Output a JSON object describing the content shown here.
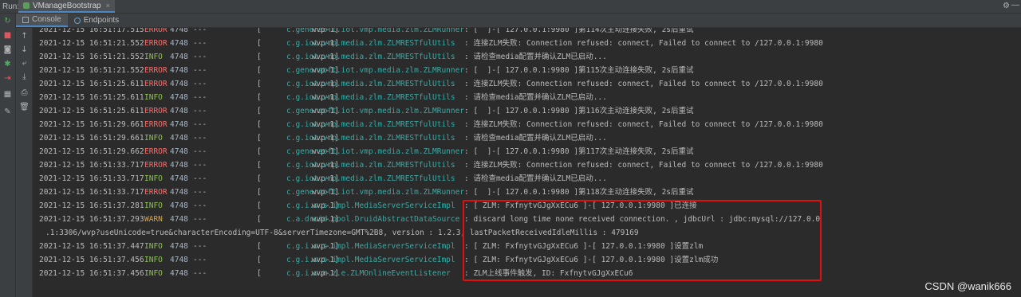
{
  "topbar": {
    "run_label": "Run:",
    "run_tab": "VManageBootstrap",
    "close": "×",
    "gear": "⚙",
    "minimize": "—"
  },
  "subbar": {
    "tabs": [
      {
        "label": "Console"
      },
      {
        "label": "Endpoints"
      }
    ]
  },
  "toolbar_icons": [
    {
      "name": "rerun-icon",
      "glyph": "↻",
      "color": "#59a869"
    },
    {
      "name": "stop-icon",
      "glyph": "■",
      "color": "#db5860"
    },
    {
      "name": "screenshot-icon",
      "glyph": "◙",
      "color": "#afb1b3"
    },
    {
      "name": "debug-icon",
      "glyph": "✱",
      "color": "#59a869"
    },
    {
      "name": "exit-icon",
      "glyph": "⇥",
      "color": "#db5860"
    },
    {
      "name": "layout-icon",
      "glyph": "▦",
      "color": "#afb1b3"
    },
    {
      "name": "pin-icon",
      "glyph": "✎",
      "color": "#afb1b3"
    }
  ],
  "console_icons": [
    {
      "name": "scroll-up-icon",
      "glyph": "↑"
    },
    {
      "name": "scroll-down-icon",
      "glyph": "↓"
    },
    {
      "name": "soft-wrap-icon",
      "glyph": "⤶"
    },
    {
      "name": "scroll-to-end-icon",
      "glyph": "⤓"
    },
    {
      "name": "print-icon",
      "glyph": "⎙"
    },
    {
      "name": "clear-icon",
      "glyph": "🗑"
    }
  ],
  "log_lines": [
    {
      "ts": "2021-12-15 16:51:17.515",
      "level": "ERROR",
      "pid": "4748",
      "dash": "---",
      "thread": "[           wvp-1]",
      "logger": "c.genersoft.iot.vmp.media.zlm.ZLMRunner",
      "msg": ": [  ]-[ 127.0.0.1:9980 ]第114次主动连接失败, 2s后重试"
    },
    {
      "ts": "2021-12-15 16:51:21.552",
      "level": "ERROR",
      "pid": "4748",
      "dash": "---",
      "thread": "[           wvp-1]",
      "logger": "c.g.iot.vmp.media.zlm.ZLMRESTfulUtils",
      "msg": ": 连接ZLM失败: Connection refused: connect, Failed to connect to /127.0.0.1:9980"
    },
    {
      "ts": "2021-12-15 16:51:21.552",
      "level": "INFO",
      "pid": "4748",
      "dash": "---",
      "thread": "[           wvp-1]",
      "logger": "c.g.iot.vmp.media.zlm.ZLMRESTfulUtils",
      "msg": ": 请检查media配置并确认ZLM已启动..."
    },
    {
      "ts": "2021-12-15 16:51:21.552",
      "level": "ERROR",
      "pid": "4748",
      "dash": "---",
      "thread": "[           wvp-1]",
      "logger": "c.genersoft.iot.vmp.media.zlm.ZLMRunner",
      "msg": ": [  ]-[ 127.0.0.1:9980 ]第115次主动连接失败, 2s后重试"
    },
    {
      "ts": "2021-12-15 16:51:25.611",
      "level": "ERROR",
      "pid": "4748",
      "dash": "---",
      "thread": "[           wvp-1]",
      "logger": "c.g.iot.vmp.media.zlm.ZLMRESTfulUtils",
      "msg": ": 连接ZLM失败: Connection refused: connect, Failed to connect to /127.0.0.1:9980"
    },
    {
      "ts": "2021-12-15 16:51:25.611",
      "level": "INFO",
      "pid": "4748",
      "dash": "---",
      "thread": "[           wvp-1]",
      "logger": "c.g.iot.vmp.media.zlm.ZLMRESTfulUtils",
      "msg": ": 请检查media配置并确认ZLM已启动..."
    },
    {
      "ts": "2021-12-15 16:51:25.611",
      "level": "ERROR",
      "pid": "4748",
      "dash": "---",
      "thread": "[           wvp-1]",
      "logger": "c.genersoft.iot.vmp.media.zlm.ZLMRunner",
      "msg": ": [  ]-[ 127.0.0.1:9980 ]第116次主动连接失败, 2s后重试"
    },
    {
      "ts": "2021-12-15 16:51:29.661",
      "level": "ERROR",
      "pid": "4748",
      "dash": "---",
      "thread": "[           wvp-1]",
      "logger": "c.g.iot.vmp.media.zlm.ZLMRESTfulUtils",
      "msg": ": 连接ZLM失败: Connection refused: connect, Failed to connect to /127.0.0.1:9980"
    },
    {
      "ts": "2021-12-15 16:51:29.661",
      "level": "INFO",
      "pid": "4748",
      "dash": "---",
      "thread": "[           wvp-1]",
      "logger": "c.g.iot.vmp.media.zlm.ZLMRESTfulUtils",
      "msg": ": 请检查media配置并确认ZLM已启动..."
    },
    {
      "ts": "2021-12-15 16:51:29.662",
      "level": "ERROR",
      "pid": "4748",
      "dash": "---",
      "thread": "[           wvp-1]",
      "logger": "c.genersoft.iot.vmp.media.zlm.ZLMRunner",
      "msg": ": [  ]-[ 127.0.0.1:9980 ]第117次主动连接失败, 2s后重试"
    },
    {
      "ts": "2021-12-15 16:51:33.717",
      "level": "ERROR",
      "pid": "4748",
      "dash": "---",
      "thread": "[           wvp-1]",
      "logger": "c.g.iot.vmp.media.zlm.ZLMRESTfulUtils",
      "msg": ": 连接ZLM失败: Connection refused: connect, Failed to connect to /127.0.0.1:9980"
    },
    {
      "ts": "2021-12-15 16:51:33.717",
      "level": "INFO",
      "pid": "4748",
      "dash": "---",
      "thread": "[           wvp-1]",
      "logger": "c.g.iot.vmp.media.zlm.ZLMRESTfulUtils",
      "msg": ": 请检查media配置并确认ZLM已启动..."
    },
    {
      "ts": "2021-12-15 16:51:33.717",
      "level": "ERROR",
      "pid": "4748",
      "dash": "---",
      "thread": "[           wvp-1]",
      "logger": "c.genersoft.iot.vmp.media.zlm.ZLMRunner",
      "msg": ": [  ]-[ 127.0.0.1:9980 ]第118次主动连接失败, 2s后重试"
    },
    {
      "ts": "2021-12-15 16:51:37.281",
      "level": "INFO",
      "pid": "4748",
      "dash": "---",
      "thread": "[           wvp-1]",
      "logger": "c.g.i.v.s.impl.MediaServerServiceImpl",
      "msg": ": [ ZLM: FxfnytvGJgXxECu6 ]-[ 127.0.0.1:9980 ]已连接"
    },
    {
      "ts": "2021-12-15 16:51:37.293",
      "level": "WARN",
      "pid": "4748",
      "dash": "---",
      "thread": "[           wvp-1]",
      "logger": "c.a.druid.pool.DruidAbstractDataSource",
      "msg": ": discard long time none received connection. , jdbcUrl : jdbc:mysql://127.0.0"
    },
    {
      "continuation": ".1:3306/wvp?useUnicode=true&characterEncoding=UTF-8&serverTimezone=GMT%2B8, version : 1.2.3, lastPacketReceivedIdleMillis : 479169"
    },
    {
      "ts": "2021-12-15 16:51:37.447",
      "level": "INFO",
      "pid": "4748",
      "dash": "---",
      "thread": "[           wvp-1]",
      "logger": "c.g.i.v.s.impl.MediaServerServiceImpl",
      "msg": ": [ ZLM: FxfnytvGJgXxECu6 ]-[ 127.0.0.1:9980 ]设置zlm"
    },
    {
      "ts": "2021-12-15 16:51:37.456",
      "level": "INFO",
      "pid": "4748",
      "dash": "---",
      "thread": "[           wvp-1]",
      "logger": "c.g.i.v.s.impl.MediaServerServiceImpl",
      "msg": ": [ ZLM: FxfnytvGJgXxECu6 ]-[ 127.0.0.1:9980 ]设置zlm成功"
    },
    {
      "ts": "2021-12-15 16:51:37.456",
      "level": "INFO",
      "pid": "4748",
      "dash": "---",
      "thread": "[           wvp-1]",
      "logger": "c.g.i.v.m.z.e.ZLMOnlineEventListener",
      "msg": ": ZLM上线事件触发, ID: FxfnytvGJgXxECu6"
    }
  ],
  "watermark": "CSDN @wanik666",
  "colors": {
    "error": "#ff6b68",
    "info": "#8bc34a",
    "warn": "#d9a343",
    "logger": "#3aa9a4",
    "highlight_box": "#e01010"
  }
}
